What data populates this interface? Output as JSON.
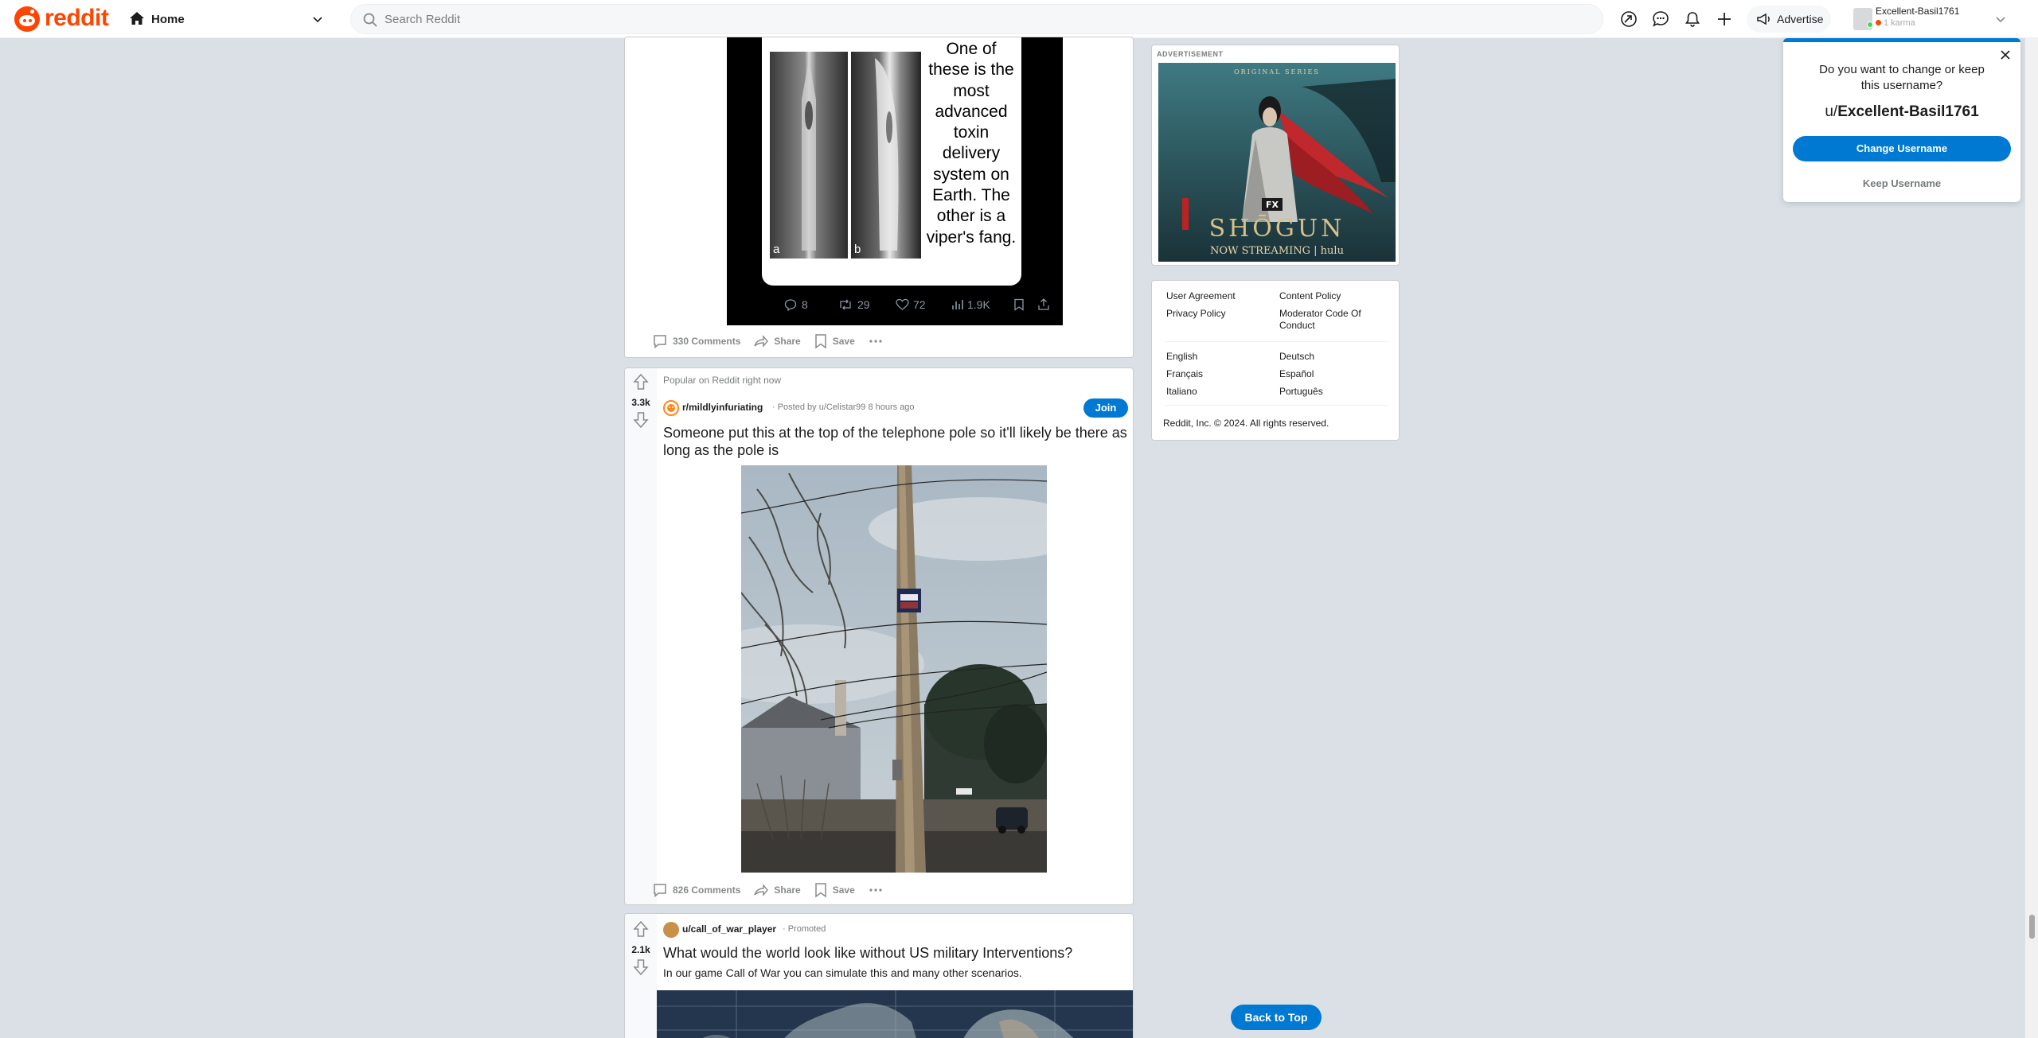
{
  "header": {
    "logo_text": "reddit",
    "home_label": "Home",
    "search_placeholder": "Search Reddit",
    "advertise_label": "Advertise",
    "username": "Excellent-Basil1761",
    "karma": "1 karma"
  },
  "posts": [
    {
      "tweet_text": "One of these is the most advanced toxin delivery system on Earth. The other is a viper's fang.",
      "tweet_img_a_label": "a",
      "tweet_img_b_label": "b",
      "tweet_stats": {
        "replies": "8",
        "retweets": "29",
        "likes": "72",
        "views": "1.9K"
      },
      "comments": "330 Comments",
      "share": "Share",
      "save": "Save"
    },
    {
      "tag": "Popular on Reddit right now",
      "votes": "3.3k",
      "subreddit": "r/mildlyinfuriating",
      "posted_by": "· Posted by u/Celistar99 8 hours ago",
      "join": "Join",
      "title": "Someone put this at the top of the telephone pole so it'll likely be there as long as the pole is",
      "comments": "826 Comments",
      "share": "Share",
      "save": "Save"
    },
    {
      "votes": "2.1k",
      "author": "u/call_of_war_player",
      "promoted": "· Promoted",
      "title": "What would the world look like without US military Interventions?",
      "body": "In our game Call of War you can simulate this and many other scenarios."
    }
  ],
  "ad": {
    "label": "ADVERTISEMENT",
    "series_line": "ORIGINAL SERIES",
    "network": "FX",
    "title": "SHŌGUN",
    "streaming": "NOW STREAMING | hulu"
  },
  "footer": {
    "links_col1": [
      "User Agreement",
      "Privacy Policy"
    ],
    "links_col2": [
      "Content Policy",
      "Moderator Code Of Conduct"
    ],
    "langs_col1": [
      "English",
      "Français",
      "Italiano"
    ],
    "langs_col2": [
      "Deutsch",
      "Español",
      "Português"
    ],
    "copyright": "Reddit, Inc. © 2024. All rights reserved."
  },
  "popup": {
    "question": "Do you want to change or keep this username?",
    "prefix": "u/",
    "username": "Excellent-Basil1761",
    "change_label": "Change Username",
    "keep_label": "Keep Username"
  },
  "back_to_top": "Back to Top",
  "colors": {
    "brand": "#ff4500",
    "accent": "#0079d3",
    "page_bg": "#dae0e6"
  }
}
